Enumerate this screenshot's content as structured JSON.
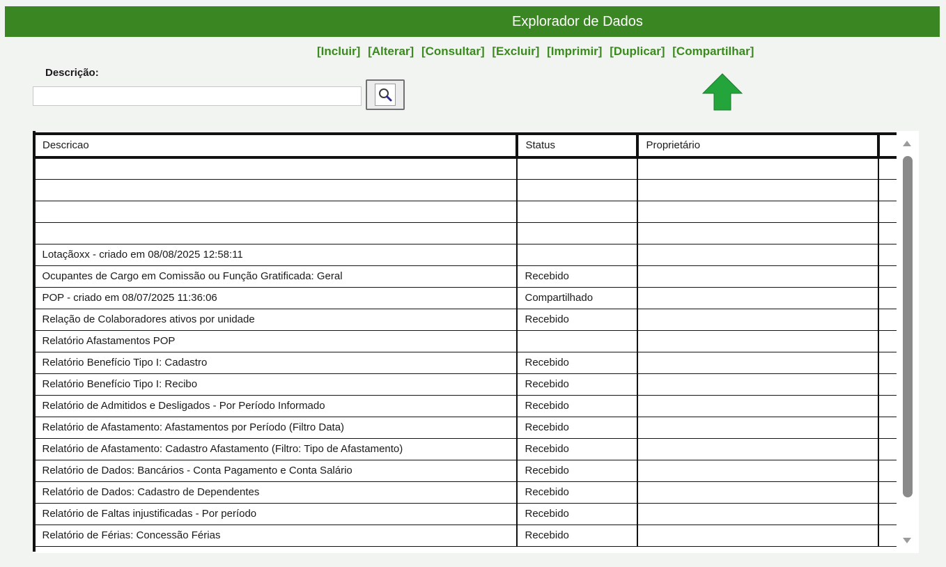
{
  "header": {
    "title": "Explorador de Dados"
  },
  "actions": [
    "[Incluir]",
    "[Alterar]",
    "[Consultar]",
    "[Excluir]",
    "[Imprimir]",
    "[Duplicar]",
    "[Compartilhar]"
  ],
  "search": {
    "label": "Descrição:",
    "value": "",
    "icon": "search-icon"
  },
  "colors": {
    "header_bg": "#3a8622",
    "action_text": "#3a8a1e",
    "arrow": "#24a53b"
  },
  "grid": {
    "columns": [
      "Descricao",
      "Status",
      "Proprietário",
      ""
    ],
    "rows": [
      [
        "",
        "",
        "",
        ""
      ],
      [
        "",
        "",
        "",
        ""
      ],
      [
        "",
        "",
        "",
        ""
      ],
      [
        "",
        "",
        "",
        ""
      ],
      [
        "Lotaçãoxx - criado em 08/08/2025 12:58:11",
        "",
        "",
        ""
      ],
      [
        "Ocupantes de Cargo em Comissão ou Função Gratificada: Geral",
        "Recebido",
        "",
        ""
      ],
      [
        "POP - criado em 08/07/2025 11:36:06",
        "Compartilhado",
        "",
        ""
      ],
      [
        "Relação de Colaboradores ativos por unidade",
        "Recebido",
        "",
        ""
      ],
      [
        "Relatório Afastamentos POP",
        "",
        "",
        ""
      ],
      [
        "Relatório Benefício Tipo I: Cadastro",
        "Recebido",
        "",
        ""
      ],
      [
        "Relatório Benefício Tipo I: Recibo",
        "Recebido",
        "",
        ""
      ],
      [
        "Relatório de Admitidos e Desligados - Por Período Informado",
        "Recebido",
        "",
        ""
      ],
      [
        "Relatório de Afastamento: Afastamentos por Período (Filtro Data)",
        "Recebido",
        "",
        ""
      ],
      [
        "Relatório de Afastamento: Cadastro Afastamento (Filtro: Tipo de Afastamento)",
        "Recebido",
        "",
        ""
      ],
      [
        "Relatório de Dados: Bancários - Conta Pagamento e Conta Salário",
        "Recebido",
        "",
        ""
      ],
      [
        "Relatório de Dados: Cadastro de Dependentes",
        "Recebido",
        "",
        ""
      ],
      [
        "Relatório de Faltas injustificadas - Por período",
        "Recebido",
        "",
        ""
      ],
      [
        "Relatório de Férias: Concessão Férias",
        "Recebido",
        "",
        ""
      ]
    ]
  }
}
